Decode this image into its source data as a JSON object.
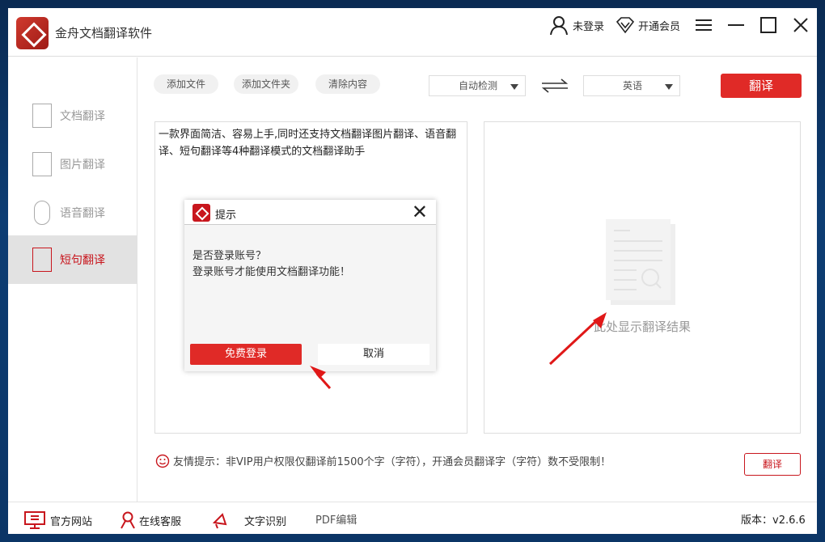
{
  "app": {
    "title": "金舟文档翻译软件",
    "brand_color": "#c8161d",
    "accent_red": "#e02a27"
  },
  "header": {
    "user_label": "未登录",
    "vip_label": "开通会员",
    "icons": [
      "user-icon",
      "diamond-icon",
      "menu-icon",
      "minimize-icon",
      "maximize-icon",
      "close-icon"
    ]
  },
  "sidebar": {
    "items": [
      {
        "label": "文档翻译",
        "icon": "document-icon",
        "active": false
      },
      {
        "label": "图片翻译",
        "icon": "image-icon",
        "active": false
      },
      {
        "label": "语音翻译",
        "icon": "microphone-icon",
        "active": false
      },
      {
        "label": "短句翻译",
        "icon": "sentence-icon",
        "active": true
      }
    ]
  },
  "toolbar": {
    "add_file": "添加文件",
    "add_folder": "添加文件夹",
    "clear": "清除内容",
    "source_lang": "自动检测",
    "target_lang": "英语",
    "translate": "翻译"
  },
  "source": {
    "text": "一款界面简洁、容易上手,同时还支持文档翻译图片翻译、语音翻译、短句翻译等4种翻译模式的文档翻译助手"
  },
  "result": {
    "placeholder": "此处显示翻译结果"
  },
  "dialog": {
    "title": "提示",
    "line1": "是否登录账号？",
    "line2": "登录账号才能使用文档翻译功能！",
    "ok": "免费登录",
    "cancel": "取消"
  },
  "tip": {
    "text": "友情提示：非VIP用户权限仅翻译前1500个字（字符），开通会员翻译字（字符）数不受限制！",
    "button": "翻译"
  },
  "footer": {
    "website": "官方网站",
    "service": "在线客服",
    "ocr": "文字识别",
    "pdf": "PDF编辑",
    "version": "版本：v2.6.6"
  }
}
